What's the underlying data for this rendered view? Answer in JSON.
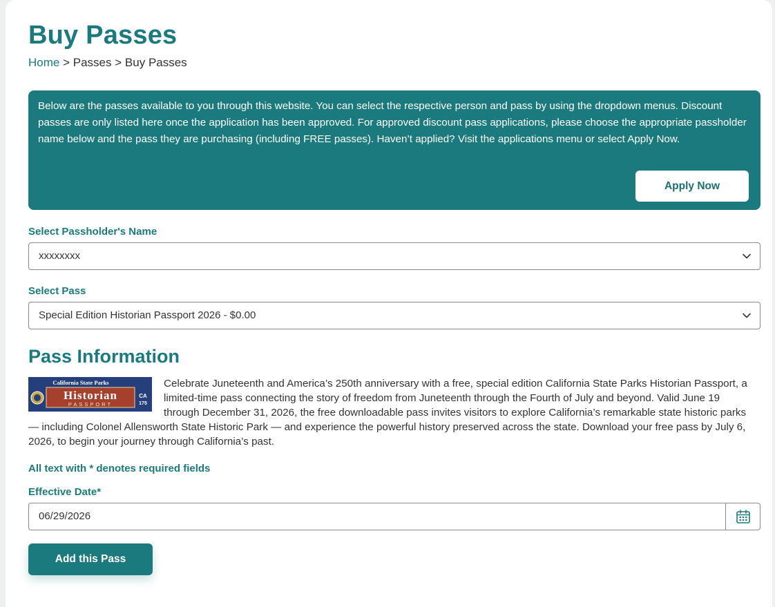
{
  "page": {
    "title": "Buy Passes",
    "breadcrumb": {
      "home": "Home",
      "sep1": ">",
      "passes": "Passes",
      "sep2": ">",
      "current": "Buy Passes"
    }
  },
  "info_box": {
    "text": "Below are the passes available to you through this website. You can select the respective person and pass by using the dropdown menus. Discount passes are only listed here once the application has been approved. For approved discount pass applications, please choose the appropriate passholder name below and the pass they are purchasing (including FREE passes). Haven’t applied? Visit the applications menu or select Apply Now.",
    "apply_button": "Apply Now"
  },
  "passholder": {
    "label": "Select Passholder's Name",
    "value": "xxxxxxxx"
  },
  "pass_select": {
    "label": "Select Pass",
    "value": "Special Edition Historian Passport 2026 - $0.00"
  },
  "pass_info": {
    "heading": "Pass Information",
    "image": {
      "top_text": "California State Parks",
      "main_text": "Historian",
      "sub_text": "PASSPORT",
      "badge_top": "CA",
      "badge_num": "175"
    },
    "description": "Celebrate Juneteenth and America’s 250th anniversary with a free, special edition California State Parks Historian Passport, a limited-time pass connecting the story of freedom from Juneteenth through the Fourth of July and beyond. Valid June 19 through December 31, 2026, the free downloadable pass invites visitors to explore California’s remarkable state historic parks — including Colonel Allensworth State Historic Park — and experience the powerful history preserved across the state. Download your free pass by July 6, 2026, to begin your journey through California’s past."
  },
  "form": {
    "required_note": "All text with * denotes required fields",
    "effective_date_label": "Effective Date*",
    "effective_date_value": "06/29/2026",
    "add_button": "Add this Pass"
  },
  "colors": {
    "accent": "#1b7a7d",
    "background": "#eef0f0",
    "card": "#ffffff"
  },
  "icons": [
    "chevron-down-icon",
    "calendar-icon"
  ]
}
